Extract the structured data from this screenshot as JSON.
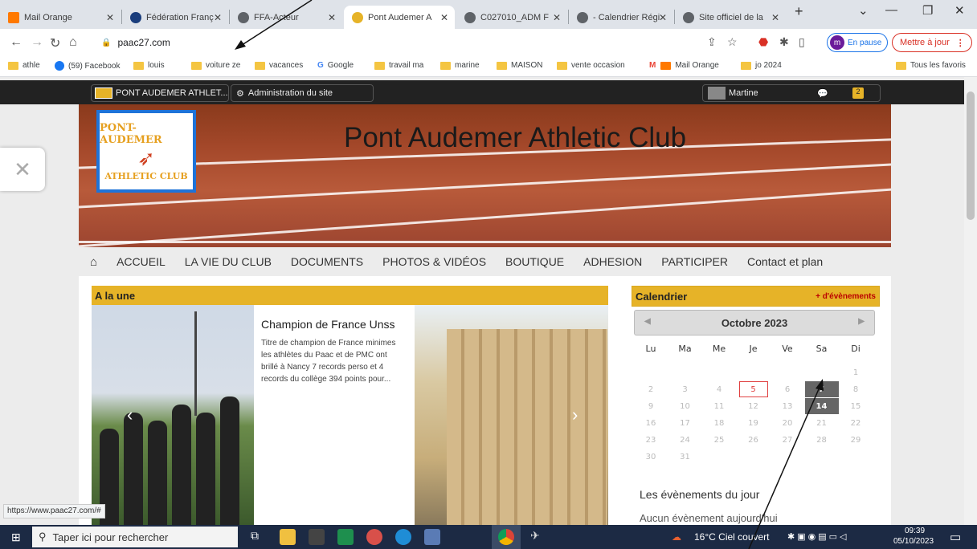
{
  "tabs": [
    {
      "title": "Mail Orange",
      "fav_color": "#ff7900"
    },
    {
      "title": "Fédération Franç",
      "fav_color": "#1a3d7c"
    },
    {
      "title": "FFA-Acteur",
      "fav_color": "#5f6368"
    },
    {
      "title": "Pont Audemer A",
      "fav_color": "#e6b328"
    },
    {
      "title": "C027010_ADM F",
      "fav_color": "#5f6368"
    },
    {
      "title": "- Calendrier Régi",
      "fav_color": "#5f6368"
    },
    {
      "title": "Site officiel de la",
      "fav_color": "#5f6368"
    }
  ],
  "address": {
    "url": "paac27.com"
  },
  "profile": {
    "initial": "m",
    "label": "En pause"
  },
  "update_label": "Mettre à jour",
  "bookmarks": [
    "athle",
    "(59) Facebook",
    "louis",
    "voiture ze",
    "vacances",
    "Google",
    "travail ma",
    "marine",
    "MAISON",
    "vente occasion",
    "Mail Orange",
    "jo 2024",
    "Tous les favoris"
  ],
  "adminbar": {
    "site": "PONT AUDEMER ATHLET...",
    "admin": "Administration du site",
    "user": "Martine",
    "badge": "2"
  },
  "site": {
    "title": "Pont Audemer Athletic Club",
    "logo_line1": "PONT-AUDEMER",
    "logo_line2": "ATHLETIC CLUB",
    "menu": [
      "ACCUEIL",
      "LA VIE DU CLUB",
      "DOCUMENTS",
      "PHOTOS & VIDÉOS",
      "BOUTIQUE",
      "ADHESION",
      "PARTICIPER",
      "Contact et plan"
    ]
  },
  "une": {
    "heading": "A la une",
    "article_title": "Champion de France Unss",
    "article_text": "Titre de champion de France minimes les athlètes du Paac et de PMC ont brillé à Nancy 7 records perso et 4 records du collège 394 points pour..."
  },
  "calendar": {
    "heading": "Calendrier",
    "events_link": "+ d'évènements",
    "month": "Octobre 2023",
    "weekdays": [
      "Lu",
      "Ma",
      "Me",
      "Je",
      "Ve",
      "Sa",
      "Di"
    ],
    "days": [
      "1",
      "2",
      "3",
      "4",
      "5",
      "6",
      "7",
      "8",
      "9",
      "10",
      "11",
      "12",
      "13",
      "14",
      "15",
      "16",
      "17",
      "18",
      "19",
      "20",
      "21",
      "22",
      "23",
      "24",
      "25",
      "26",
      "27",
      "28",
      "29",
      "30",
      "31"
    ],
    "today": "5",
    "selected": [
      "7",
      "14"
    ],
    "events_title": "Les évènements du jour",
    "events_none": "Aucun évènement aujourd'hui"
  },
  "status_url": "https://www.paac27.com/#",
  "taskbar": {
    "search_placeholder": "Taper ici pour rechercher",
    "weather": "16°C Ciel couvert",
    "time": "09:39",
    "date": "05/10/2023"
  }
}
